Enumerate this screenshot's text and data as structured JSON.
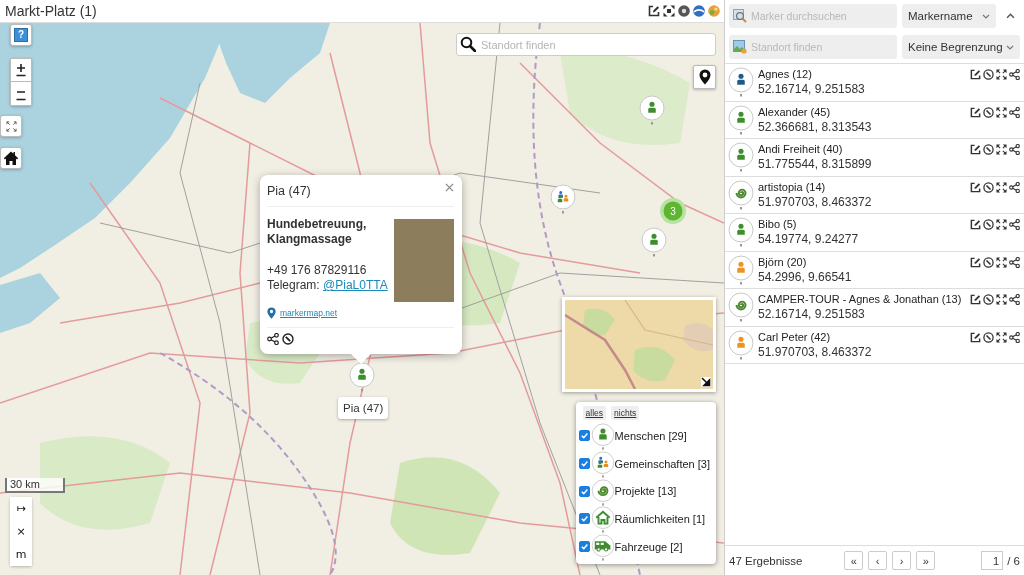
{
  "window": {
    "title": "Markt-Platz (1)"
  },
  "map": {
    "help": "?",
    "location_search": {
      "placeholder": "Standort finden"
    },
    "markers": [
      {
        "kind": "person"
      },
      {
        "kind": "group"
      },
      {
        "kind": "cluster",
        "count": "3"
      },
      {
        "kind": "person"
      },
      {
        "kind": "person",
        "label": "Pia (47)"
      }
    ],
    "popup": {
      "title": "Pia (47)",
      "description": "Hundebetreuung, Klangmassage",
      "phone": "+49 176 87829116",
      "telegram_label": "Telegram:",
      "telegram_handle": "@PiaL0TTA",
      "website": "markermap.net"
    },
    "legend": {
      "select_all": "alles",
      "select_none": "nichts",
      "items": [
        {
          "label": "Menschen [29]",
          "kind": "person",
          "checked": true
        },
        {
          "label": "Gemeinschaften [3]",
          "kind": "group",
          "checked": true
        },
        {
          "label": "Projekte [13]",
          "kind": "project",
          "checked": true
        },
        {
          "label": "Räumlichkeiten [1]",
          "kind": "space",
          "checked": true
        },
        {
          "label": "Fahrzeuge [2]",
          "kind": "vehicle",
          "checked": true
        }
      ]
    },
    "scale": "30 km",
    "measure_buttons": [
      "↦",
      "×",
      "m"
    ]
  },
  "sidebar": {
    "search": {
      "placeholder": "Marker durchsuchen"
    },
    "sort": {
      "value": "Markername"
    },
    "location": {
      "placeholder": "Standort finden"
    },
    "radius": {
      "value": "Keine Begrenzung"
    },
    "results": [
      {
        "name": "Agnes (12)",
        "coords": "52.16714, 9.251583",
        "kind": "person",
        "color": "#1f5c85"
      },
      {
        "name": "Alexander (45)",
        "coords": "52.366681, 8.313543",
        "kind": "person",
        "color": "#3e8e2e"
      },
      {
        "name": "Andi Freiheit (40)",
        "coords": "51.775544, 8.315899",
        "kind": "person",
        "color": "#3e8e2e"
      },
      {
        "name": "artistopia (14)",
        "coords": "51.970703, 8.463372",
        "kind": "project",
        "color": "#4b8a2b"
      },
      {
        "name": "Bibo (5)",
        "coords": "54.19774, 9.24277",
        "kind": "person",
        "color": "#3e8e2e"
      },
      {
        "name": "Björn (20)",
        "coords": "54.2996, 9.66541",
        "kind": "person",
        "color": "#ee9322"
      },
      {
        "name": "CAMPER-TOUR - Agnes & Jonathan (13)",
        "coords": "52.16714, 9.251583",
        "kind": "project",
        "color": "#4b8a2b"
      },
      {
        "name": "Carl Peter (42)",
        "coords": "51.970703, 8.463372",
        "kind": "person",
        "color": "#ee9322"
      }
    ],
    "result_count": "47 Ergebnisse",
    "pagination": {
      "buttons": [
        "«",
        "‹",
        "›",
        "»"
      ],
      "page": "1",
      "total": "/ 6"
    }
  }
}
